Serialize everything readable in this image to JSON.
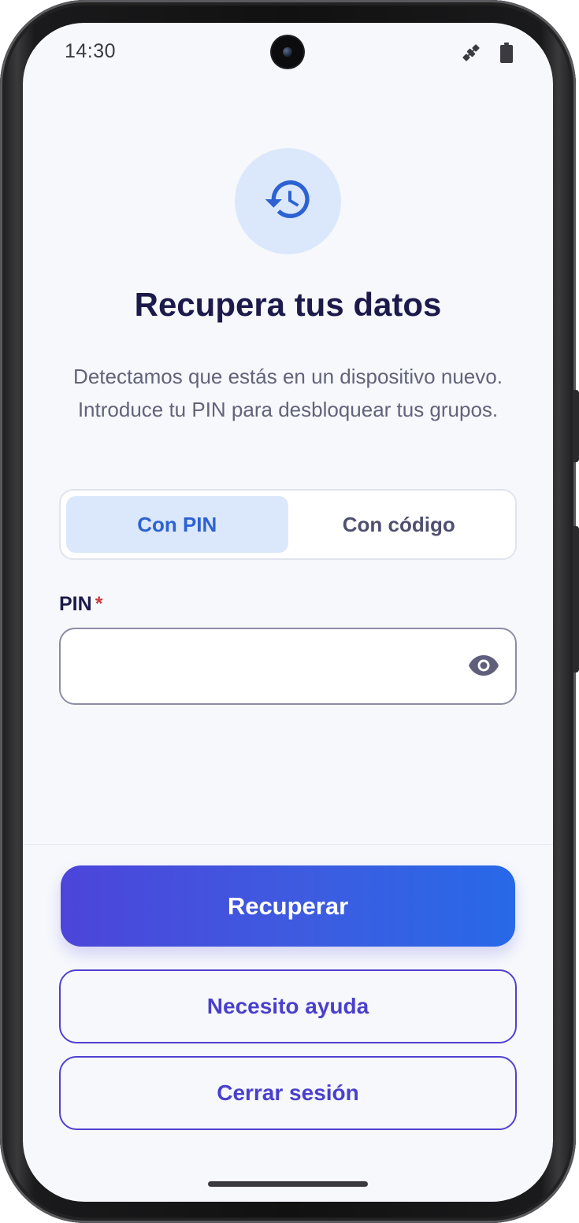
{
  "status_bar": {
    "time": "14:30",
    "icons": [
      "satellite-icon",
      "battery-icon"
    ]
  },
  "hero": {
    "icon": "history-icon",
    "accent": "#2d62d2"
  },
  "title": "Recupera tus datos",
  "subtitle": "Detectamos que estás en un dispositivo nuevo. Introduce tu PIN para desbloquear tus grupos.",
  "tabs": [
    {
      "label": "Con PIN",
      "active": true
    },
    {
      "label": "Con código",
      "active": false
    }
  ],
  "pin_field": {
    "label": "PIN",
    "required_mark": "*",
    "value": "",
    "placeholder": ""
  },
  "actions": {
    "primary": "Recuperar",
    "help": "Necesito ayuda",
    "logout": "Cerrar sesión"
  },
  "colors": {
    "primary_gradient_start": "#4c45da",
    "primary_gradient_end": "#2769e8",
    "outline": "#5040d0",
    "title": "#1c1a4a",
    "required": "#d03a3a"
  }
}
